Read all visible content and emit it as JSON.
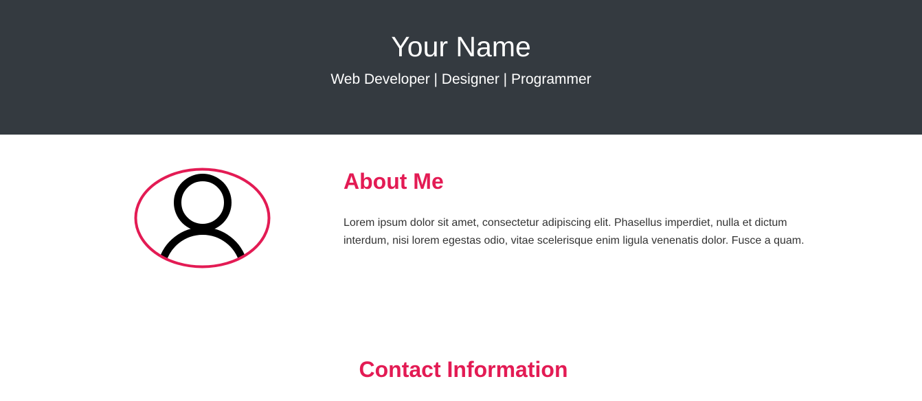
{
  "header": {
    "name": "Your Name",
    "tagline": "Web Developer | Designer | Programmer"
  },
  "about": {
    "title": "About Me",
    "text": "Lorem ipsum dolor sit amet, consectetur adipiscing elit. Phasellus imperdiet, nulla et dictum interdum, nisi lorem egestas odio, vitae scelerisque enim ligula venenatis dolor. Fusce a quam.",
    "avatar_icon": "user-profile-icon"
  },
  "contact": {
    "title": "Contact Information"
  },
  "colors": {
    "header_bg": "#343a40",
    "accent": "#e31b54"
  }
}
